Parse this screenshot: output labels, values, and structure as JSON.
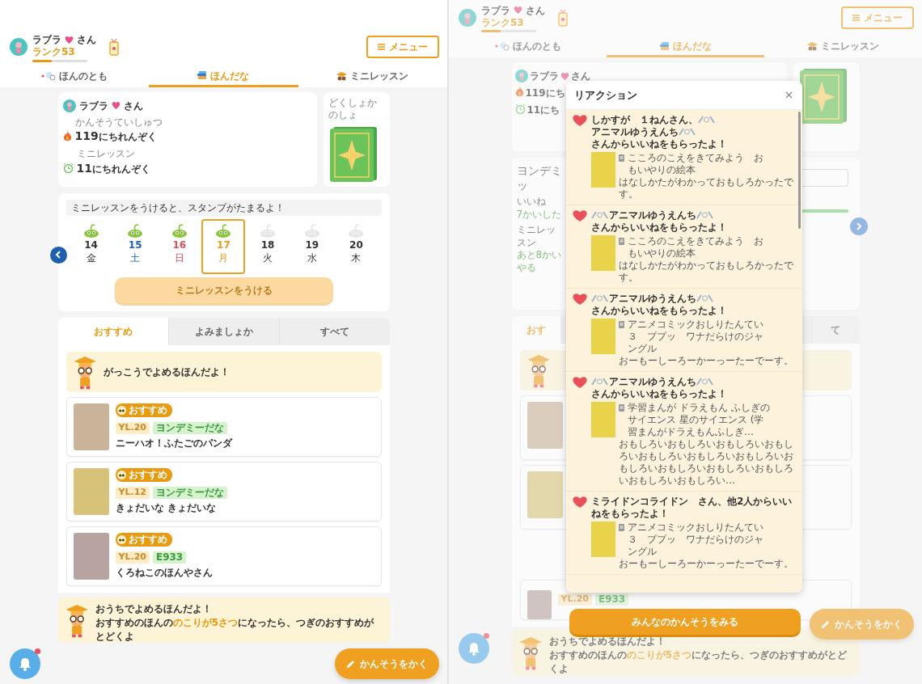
{
  "left_screen": {
    "header": {
      "user_name": "ラブラ",
      "honorific": "さん",
      "rank": "ランク53",
      "rank_progress": {
        "level": 0.35
      }
    },
    "menu_button": "メニュー",
    "tabs": [
      {
        "label": "ほんのとも",
        "selected": false
      },
      {
        "label": "ほんだな",
        "selected": true
      },
      {
        "label": "ミニレッスン",
        "selected": false
      }
    ],
    "profile": {
      "user_name": "ラブラ",
      "honorific": "さん",
      "stats": [
        {
          "kind": "streak",
          "caption": "かんそうていしゅつ",
          "value": "119",
          "unit": "にちれんぞく"
        },
        {
          "kind": "lesson",
          "caption": "ミニレッスン",
          "value": "11",
          "unit": "にちれんぞく"
        }
      ],
      "side_caption": "どくしょかのしょ"
    },
    "stamp_card": {
      "hint": "ミニレッスンをうけると、スタンプがたまるよ！",
      "days": [
        {
          "day": "14",
          "weekday": "金",
          "kind": "weekday",
          "stamped": true,
          "selected": false
        },
        {
          "day": "15",
          "weekday": "土",
          "kind": "saturday",
          "stamped": true,
          "selected": false
        },
        {
          "day": "16",
          "weekday": "日",
          "kind": "sunday",
          "stamped": true,
          "selected": false
        },
        {
          "day": "17",
          "weekday": "月",
          "kind": "weekday",
          "stamped": true,
          "selected": true
        },
        {
          "day": "18",
          "weekday": "火",
          "kind": "weekday",
          "stamped": false,
          "selected": false
        },
        {
          "day": "19",
          "weekday": "水",
          "kind": "weekday",
          "stamped": false,
          "selected": false
        },
        {
          "day": "20",
          "weekday": "木",
          "kind": "weekday",
          "stamped": false,
          "selected": false
        }
      ],
      "button": {
        "label": "ミニレッスンをうける",
        "disabled": true
      }
    },
    "list_tabs": [
      {
        "label": "おすすめ",
        "selected": true
      },
      {
        "label": "よみましょか",
        "selected": false
      },
      {
        "label": "すべて",
        "selected": false
      }
    ],
    "notice": "がっこうでよめるほんだよ！",
    "books": [
      {
        "badge": "おすすめ",
        "level": "YL.20",
        "tag": "ヨンデミーだな",
        "title": "ニーハオ！ふたごのパンダ"
      },
      {
        "badge": "おすすめ",
        "level": "YL.12",
        "tag": "ヨンデミーだな",
        "title": "きょだいな きょだいな"
      },
      {
        "badge": "おすすめ",
        "level": "YL.20",
        "tag": "E933",
        "title": "くろねこのほんやさん"
      }
    ],
    "home_banner": {
      "title": "おうちでよめるほんだよ！",
      "text": "おすすめのほんの**のこりが5さつ**になったら、つぎのおすすめがとどくよ"
    },
    "notification": {
      "unread": true
    },
    "write_button": "かんそうをかく"
  },
  "right_screen": {
    "header": {
      "user_name": "ラブラ",
      "honorific": "さん",
      "rank": "ランク53",
      "rank_progress": {
        "level": 0.35
      }
    },
    "menu_button": "メニュー",
    "tabs": [
      {
        "label": "ほんのとも",
        "selected": false
      },
      {
        "label": "ほんだな",
        "selected": true
      },
      {
        "label": "ミニレッスン",
        "selected": false
      }
    ],
    "profile": {
      "user_name": "ラブラ",
      "honorific": "さん",
      "stats": [
        {
          "kind": "streak",
          "value": "119",
          "unit": "にち"
        },
        {
          "kind": "lesson",
          "value": "11",
          "unit": "にち"
        }
      ]
    },
    "yondemy_card": {
      "title": "ヨンデミッ",
      "rows": [
        {
          "label": "いいね",
          "value": "7かいした"
        },
        {
          "label": "ミニレッスン",
          "value": "あと8かいやる"
        }
      ],
      "progress": {
        "level": 1
      }
    },
    "list_tabs": [
      {
        "label": "おす",
        "selected": true
      },
      {
        "label": "て",
        "selected": false
      }
    ],
    "book": {
      "level": "YL.20",
      "tag": "E933"
    },
    "home_banner": {
      "title": "おうちでよめるほんだよ！",
      "text": "おすすめのほんの**のこりが5さつ**になったら、つぎのおすすめがとどくよ"
    },
    "notification": {
      "unread": true
    },
    "write_button": "かんそうをかく",
    "reaction_modal": {
      "title": "リアクション",
      "items": [
        {
          "message": [
            {
              "kind": "text",
              "text": "しかすが　１ねんさん、"
            },
            {
              "kind": "ornament"
            },
            {
              "kind": "text",
              "text": "アニマルゆうえんち"
            },
            {
              "kind": "ornament"
            },
            {
              "kind": "text",
              "text": "さんからいいねをもらったよ！"
            }
          ],
          "book": "こころのこえをきてみよう　おもいやりの絵本",
          "comment": "はなしかたがわかっておもしろかったです。"
        },
        {
          "message": [
            {
              "kind": "ornament"
            },
            {
              "kind": "text",
              "text": "アニマルゆうえんち"
            },
            {
              "kind": "ornament"
            },
            {
              "kind": "text",
              "text": "さんからいいねをもらったよ！"
            }
          ],
          "book": "こころのこえをきてみよう　おもいやりの絵本",
          "comment": "はなしかたがわかっておもしろかったです。"
        },
        {
          "message": [
            {
              "kind": "ornament"
            },
            {
              "kind": "text",
              "text": "アニマルゆうえんち"
            },
            {
              "kind": "ornament"
            },
            {
              "kind": "text",
              "text": "さんからいいねをもらったよ！"
            }
          ],
          "book": "アニメコミックおしりたんてい３　ププッ　ワナだらけのジャングル",
          "comment": "おーもーしーろーかーっーたーでーす。"
        },
        {
          "message": [
            {
              "kind": "ornament"
            },
            {
              "kind": "text",
              "text": "アニマルゆうえんち"
            },
            {
              "kind": "ornament"
            },
            {
              "kind": "text",
              "text": "さんからいいねをもらったよ！"
            }
          ],
          "book": "学習まんが ドラえもん ふしぎのサイエンス 星のサイエンス (学習まんがドラえもんふしぎ…",
          "comment": "おもしろいおもしろいおもしろいおもしろいおもしろいおもしろいおもしろいおもしろいおもしろいおもしろいおもしろいおもしろいおもしろい…"
        },
        {
          "message": [
            {
              "kind": "text",
              "text": "ミライドンコライドン　さん、他2人からいいねをもらったよ！"
            }
          ],
          "book": "アニメコミックおしりたんてい３　ププッ　ワナだらけのジャングル",
          "comment": "おーもーしーろーかーっーたーでーす。"
        }
      ]
    },
    "see_all_button": "みんなのかんそうをみる"
  }
}
